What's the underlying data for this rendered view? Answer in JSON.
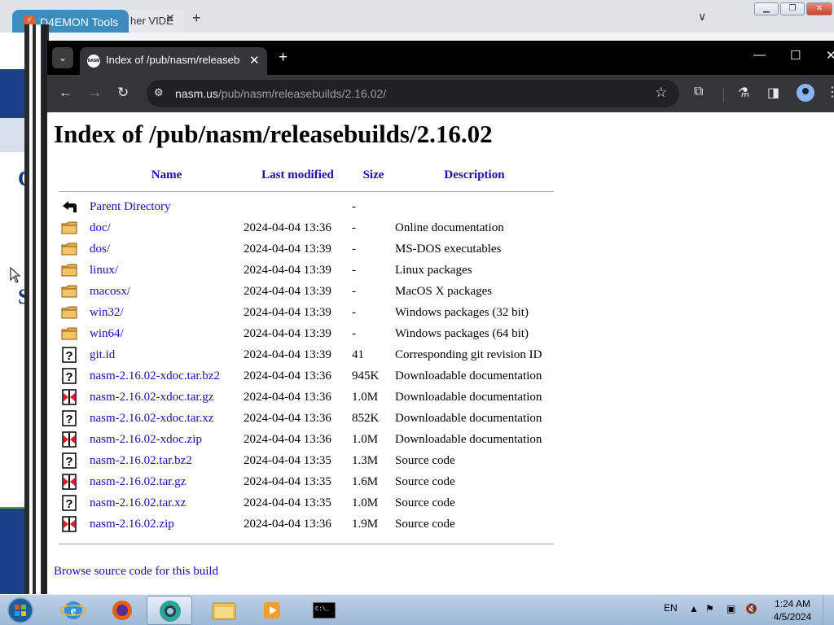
{
  "background_window": {
    "tab1_title": "D4EMON Tools",
    "tab2_title": "her VIDE",
    "letters": [
      "C",
      "S"
    ]
  },
  "browser": {
    "tab_title": "Index of /pub/nasm/releasebu",
    "favicon_label": "NASM",
    "url_host": "nasm.us",
    "url_path": "/pub/nasm/releasebuilds/2.16.02/"
  },
  "page": {
    "heading": "Index of /pub/nasm/releasebuilds/2.16.02",
    "columns": {
      "name": "Name",
      "modified": "Last modified",
      "size": "Size",
      "description": "Description"
    },
    "entries": [
      {
        "icon": "back-icon",
        "name": "Parent Directory",
        "modified": "",
        "size": "-",
        "description": ""
      },
      {
        "icon": "folder-icon",
        "name": "doc/",
        "modified": "2024-04-04 13:36",
        "size": "-",
        "description": "Online documentation"
      },
      {
        "icon": "folder-icon",
        "name": "dos/",
        "modified": "2024-04-04 13:39",
        "size": "-",
        "description": "MS-DOS executables"
      },
      {
        "icon": "folder-icon",
        "name": "linux/",
        "modified": "2024-04-04 13:39",
        "size": "-",
        "description": "Linux packages"
      },
      {
        "icon": "folder-icon",
        "name": "macosx/",
        "modified": "2024-04-04 13:39",
        "size": "-",
        "description": "MacOS X packages"
      },
      {
        "icon": "folder-icon",
        "name": "win32/",
        "modified": "2024-04-04 13:39",
        "size": "-",
        "description": "Windows packages (32 bit)"
      },
      {
        "icon": "folder-icon",
        "name": "win64/",
        "modified": "2024-04-04 13:39",
        "size": "-",
        "description": "Windows packages (64 bit)"
      },
      {
        "icon": "unknown-file-icon",
        "name": "git.id",
        "modified": "2024-04-04 13:39",
        "size": "41",
        "description": "Corresponding git revision ID"
      },
      {
        "icon": "unknown-file-icon",
        "name": "nasm-2.16.02-xdoc.tar.bz2",
        "modified": "2024-04-04 13:36",
        "size": "945K",
        "description": "Downloadable documentation"
      },
      {
        "icon": "compressed-file-icon",
        "name": "nasm-2.16.02-xdoc.tar.gz",
        "modified": "2024-04-04 13:36",
        "size": "1.0M",
        "description": "Downloadable documentation"
      },
      {
        "icon": "unknown-file-icon",
        "name": "nasm-2.16.02-xdoc.tar.xz",
        "modified": "2024-04-04 13:36",
        "size": "852K",
        "description": "Downloadable documentation"
      },
      {
        "icon": "compressed-file-icon",
        "name": "nasm-2.16.02-xdoc.zip",
        "modified": "2024-04-04 13:36",
        "size": "1.0M",
        "description": "Downloadable documentation"
      },
      {
        "icon": "unknown-file-icon",
        "name": "nasm-2.16.02.tar.bz2",
        "modified": "2024-04-04 13:35",
        "size": "1.3M",
        "description": "Source code"
      },
      {
        "icon": "compressed-file-icon",
        "name": "nasm-2.16.02.tar.gz",
        "modified": "2024-04-04 13:35",
        "size": "1.6M",
        "description": "Source code"
      },
      {
        "icon": "unknown-file-icon",
        "name": "nasm-2.16.02.tar.xz",
        "modified": "2024-04-04 13:35",
        "size": "1.0M",
        "description": "Source code"
      },
      {
        "icon": "compressed-file-icon",
        "name": "nasm-2.16.02.zip",
        "modified": "2024-04-04 13:36",
        "size": "1.9M",
        "description": "Source code"
      }
    ],
    "footer_link": "Browse source code for this build"
  },
  "taskbar": {
    "apps": [
      "internet-explorer",
      "firefox",
      "chrome",
      "file-explorer",
      "media-player",
      "command-prompt"
    ],
    "active_app": "chrome",
    "cmd_label": "C:\\_",
    "language": "EN",
    "time": "1:24 AM",
    "date": "4/5/2024"
  }
}
